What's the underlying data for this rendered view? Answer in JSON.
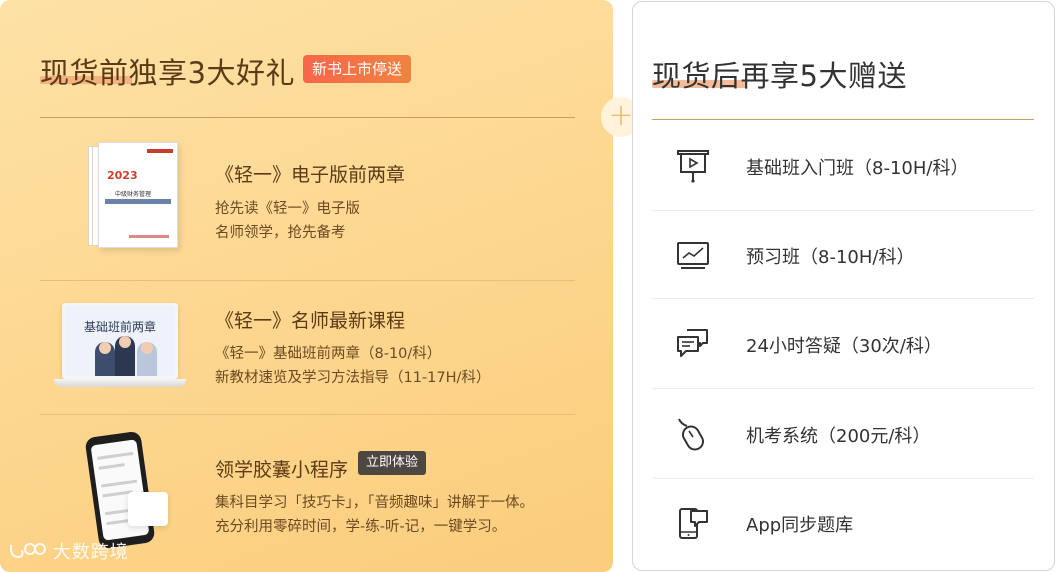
{
  "left": {
    "title": "现货前独享3大好礼",
    "tag": "新书上市停送",
    "gifts": [
      {
        "title": "《轻一》电子版前两章",
        "lines": [
          "抢先读《轻一》电子版",
          "名师领学，抢先备考"
        ]
      },
      {
        "title": "《轻一》名师最新课程",
        "lines": [
          "《轻一》基础班前两章（8-10/科）",
          "新教材速览及学习方法指导（11-17H/科）"
        ],
        "image_text": "基础班前两章"
      },
      {
        "title": "领学胶囊小程序",
        "tag": "立即体验",
        "lines": [
          "集科目学习「技巧卡」，「音频趣味」讲解于一体。",
          "充分利用零碎时间，学-练-听-记，一键学习。"
        ]
      }
    ],
    "book_cover": {
      "year": "2023",
      "title": "中级财务管理"
    }
  },
  "plus": "+",
  "right": {
    "title": "现货后再享5大赠送",
    "items": [
      {
        "label": "基础班入门班（8-10H/科）",
        "icon": "projector-screen-icon"
      },
      {
        "label": "预习班（8-10H/科）",
        "icon": "monitor-chart-icon"
      },
      {
        "label": "24小时答疑（30次/科）",
        "icon": "chat-bubbles-icon"
      },
      {
        "label": "机考系统（200元/科）",
        "icon": "mouse-icon"
      },
      {
        "label": "App同步题库",
        "icon": "phone-chat-icon"
      }
    ]
  },
  "watermark": "大数跨境",
  "colors": {
    "left_bg": "#fdd892",
    "tag_bg": "#f6664a",
    "accent_line": "#c9a064",
    "title_brown": "#5b3a17"
  }
}
